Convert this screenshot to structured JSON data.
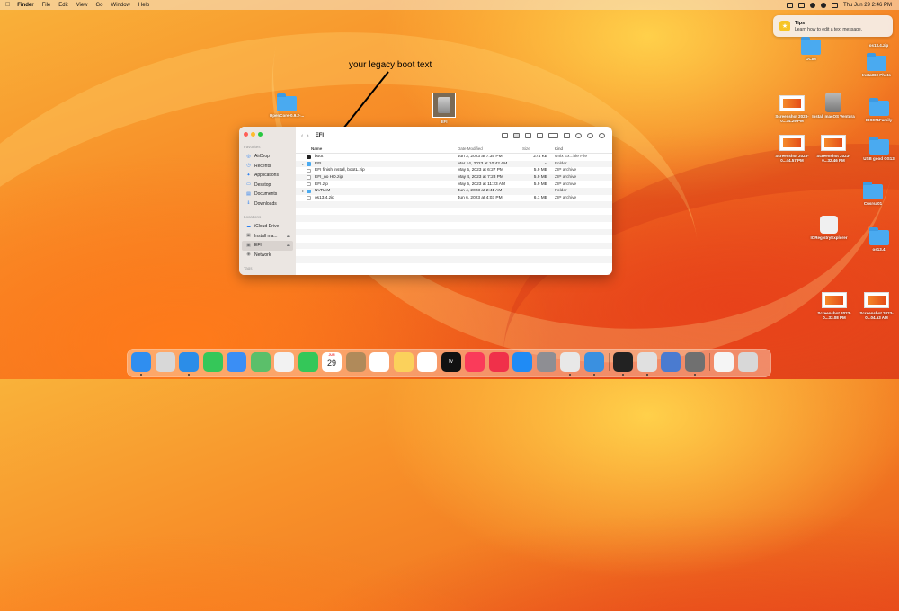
{
  "menubar": {
    "app": "Finder",
    "items": [
      "File",
      "Edit",
      "View",
      "Go",
      "Window",
      "Help"
    ],
    "datetime": "Thu Jun 29  2:46 PM"
  },
  "notification": {
    "title": "Tips",
    "body": "Learn how to edit a text message."
  },
  "annotation": "your legacy boot text",
  "desktop": {
    "icons": [
      {
        "label": "OpenCore-0.9.2-...",
        "kind": "folder"
      },
      {
        "label": "EFI",
        "kind": "disk"
      },
      {
        "label": "DCIM",
        "kind": "folder"
      },
      {
        "label": "os13.4.zip",
        "kind": "zip"
      },
      {
        "label": "Insta360 Photo",
        "kind": "folder"
      },
      {
        "label": "Screenshot 2023-0...34.29 PM",
        "kind": "screenshot"
      },
      {
        "label": "Install macOS Ventura",
        "kind": "disk"
      },
      {
        "label": "IOS071Family",
        "kind": "folder"
      },
      {
        "label": "Screenshot 2023-0...44.57 PM",
        "kind": "screenshot"
      },
      {
        "label": "Screenshot 2023-0...32.46 PM",
        "kind": "screenshot"
      },
      {
        "label": "USB good OS13",
        "kind": "folder"
      },
      {
        "label": "Cusrsa01",
        "kind": "folder"
      },
      {
        "label": "IORegistryExplorer",
        "kind": "app"
      },
      {
        "label": "os13.4",
        "kind": "folder"
      },
      {
        "label": "Screenshot 2023-0...33.08 PM",
        "kind": "screenshot"
      },
      {
        "label": "Screenshot 2023-0...04.53 AM",
        "kind": "screenshot"
      }
    ]
  },
  "finder": {
    "title": "EFI",
    "sidebar": {
      "favorites_label": "Favorites",
      "favorites": [
        {
          "label": "AirDrop",
          "icon": "airdrop-icon"
        },
        {
          "label": "Recents",
          "icon": "clock-icon"
        },
        {
          "label": "Applications",
          "icon": "applications-icon"
        },
        {
          "label": "Desktop",
          "icon": "desktop-icon"
        },
        {
          "label": "Documents",
          "icon": "document-icon"
        },
        {
          "label": "Downloads",
          "icon": "download-icon"
        }
      ],
      "locations_label": "Locations",
      "locations": [
        {
          "label": "iCloud Drive",
          "icon": "cloud-icon"
        },
        {
          "label": "Install ma...",
          "icon": "disk-icon"
        },
        {
          "label": "EFI",
          "icon": "disk-icon"
        },
        {
          "label": "Network",
          "icon": "network-icon"
        }
      ],
      "tags_label": "Tags"
    },
    "columns": {
      "name": "Name",
      "date": "Date Modified",
      "size": "Size",
      "kind": "Kind"
    },
    "rows": [
      {
        "name": "boot",
        "date": "Jun 3, 2023 at 7:35 PM",
        "size": "274 KB",
        "kind": "Unix Ex...ble File",
        "icon": "exec"
      },
      {
        "name": "EFI",
        "date": "Mar 14, 2023 at 10:42 AM",
        "size": "--",
        "kind": "Folder",
        "icon": "folder"
      },
      {
        "name": "EFI finish install, bootL.zip",
        "date": "May 5, 2023 at 6:27 PM",
        "size": "5.9 MB",
        "kind": "ZIP archive",
        "icon": "zip"
      },
      {
        "name": "EFI_no HD.zip",
        "date": "May 4, 2023 at 7:23 PM",
        "size": "5.9 MB",
        "kind": "ZIP archive",
        "icon": "zip"
      },
      {
        "name": "EFI.zip",
        "date": "May 5, 2023 at 11:23 AM",
        "size": "5.9 MB",
        "kind": "ZIP archive",
        "icon": "zip"
      },
      {
        "name": "NVRAM",
        "date": "Jun 4, 2023 at 2:41 AM",
        "size": "--",
        "kind": "Folder",
        "icon": "folder"
      },
      {
        "name": "os13.4.zip",
        "date": "Jun 6, 2023 at 4:03 PM",
        "size": "6.1 MB",
        "kind": "ZIP archive",
        "icon": "zip"
      }
    ]
  },
  "dock": {
    "calendar_day": "29",
    "tv_label": "tv",
    "apps": [
      {
        "name": "finder",
        "color": "#2f8ef0"
      },
      {
        "name": "launchpad",
        "color": "#d8d8d8"
      },
      {
        "name": "safari",
        "color": "#2b8de8"
      },
      {
        "name": "messages",
        "color": "#35c759"
      },
      {
        "name": "mail",
        "color": "#3a8ef5"
      },
      {
        "name": "maps",
        "color": "#5bbf6a"
      },
      {
        "name": "photos",
        "color": "#f2f2f2"
      },
      {
        "name": "facetime",
        "color": "#34c759"
      },
      {
        "name": "calendar",
        "color": "#ffffff"
      },
      {
        "name": "contacts",
        "color": "#b08a5a"
      },
      {
        "name": "reminders",
        "color": "#ffffff"
      },
      {
        "name": "notes",
        "color": "#fbd15b"
      },
      {
        "name": "freeform",
        "color": "#ffffff"
      },
      {
        "name": "tv",
        "color": "#111111"
      },
      {
        "name": "music",
        "color": "#fa3b5a"
      },
      {
        "name": "news",
        "color": "#f0304a"
      },
      {
        "name": "app-store",
        "color": "#1f8bf5"
      },
      {
        "name": "system-settings",
        "color": "#8e8e93"
      },
      {
        "name": "chrome",
        "color": "#e8e8e8"
      },
      {
        "name": "network-utility",
        "color": "#3a90e0"
      },
      {
        "name": "terminal",
        "color": "#222222"
      },
      {
        "name": "preview",
        "color": "#e0e0e0"
      },
      {
        "name": "screen-sharing",
        "color": "#4a7bd0"
      },
      {
        "name": "disk-utility",
        "color": "#707070"
      },
      {
        "name": "documents",
        "color": "#f5f5f5"
      },
      {
        "name": "trash",
        "color": "#d8d8d8"
      }
    ]
  }
}
